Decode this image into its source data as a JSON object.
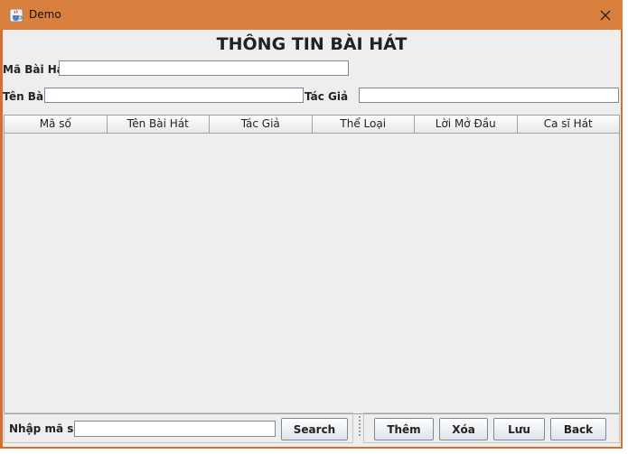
{
  "window": {
    "title": "Demo",
    "close_glyph": "✕",
    "icon": "java-cup-icon"
  },
  "form": {
    "heading": "THÔNG TIN BÀI HÁT",
    "ma_bai_hat_label": "Mã Bài Hát",
    "ma_bai_hat_value": "",
    "ten_bai_label": "Tên Bài:",
    "ten_bai_value": "",
    "tac_gia_label": "Tác Giả",
    "tac_gia_value": ""
  },
  "table": {
    "columns": [
      "Mã số",
      "Tên Bài Hát",
      "Tác Giả",
      "Thể Loại",
      "Lời Mở Đầu",
      "Ca sĩ Hát"
    ],
    "rows": []
  },
  "search": {
    "label": "Nhập mã số",
    "value": "",
    "button": "Search"
  },
  "actions": {
    "add": "Thêm",
    "delete": "Xóa",
    "save": "Lưu",
    "back": "Back"
  },
  "colors": {
    "titlebar": "#d9803f",
    "panel_bg": "#eeeeee"
  }
}
